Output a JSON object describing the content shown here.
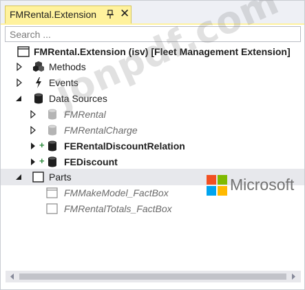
{
  "tab": {
    "title": "FMRental.Extension",
    "pin_icon": "pin-icon",
    "close_label": "✕"
  },
  "search": {
    "placeholder": "Search ..."
  },
  "tree": {
    "root": {
      "label": "FMRental.Extension (isv) [Fleet Management Extension]"
    },
    "methods": {
      "label": "Methods"
    },
    "events": {
      "label": "Events"
    },
    "data_sources": {
      "label": "Data Sources",
      "items": [
        {
          "label": "FMRental",
          "style": "inherited"
        },
        {
          "label": "FMRentalCharge",
          "style": "inherited"
        },
        {
          "label": "FERentalDiscountRelation",
          "style": "added"
        },
        {
          "label": "FEDiscount",
          "style": "added"
        }
      ]
    },
    "parts": {
      "label": "Parts",
      "items": [
        {
          "label": "FMMakeModel_FactBox"
        },
        {
          "label": "FMRentalTotals_FactBox"
        }
      ]
    }
  },
  "watermark": {
    "text": "jonpdf.com",
    "brand_text": "Microsoft"
  },
  "colors": {
    "tab_highlight": "#fff29d",
    "selected_row": "#e7e8ec",
    "added_marker": "#2e8b3e",
    "ms_red": "#f25022",
    "ms_green": "#7fba00",
    "ms_blue": "#00a4ef",
    "ms_yellow": "#ffb900"
  }
}
